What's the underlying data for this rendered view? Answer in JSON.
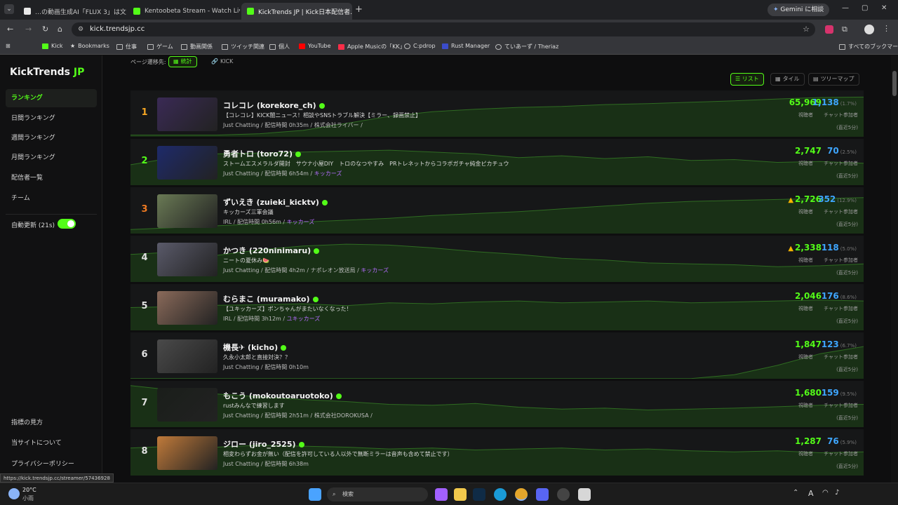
{
  "browser": {
    "tabs": [
      {
        "label": "…の動画生成AI「FLUX 3」は文…",
        "color": "#e8e8e8"
      },
      {
        "label": "Kentoobeta Stream - Watch Liv…",
        "color": "#53fc18"
      },
      {
        "label": "KickTrends JP | Kick日本配信者…",
        "color": "#53fc18"
      }
    ],
    "gemini_button": "Gemini に相談",
    "url": "kick.trendsjp.cc",
    "bookmarks": [
      {
        "label": "Kick"
      },
      {
        "label": "Bookmarks"
      },
      {
        "label": "仕事"
      },
      {
        "label": "ゲーム"
      },
      {
        "label": "動画関係"
      },
      {
        "label": "ツイッチ関連"
      },
      {
        "label": "個人"
      },
      {
        "label": "YouTube"
      },
      {
        "label": "Apple Musicの「KK」"
      },
      {
        "label": "C:pdrop"
      },
      {
        "label": "Rust Manager"
      },
      {
        "label": "ていあーず / Theriaz"
      }
    ],
    "all_bookmarks": "すべてのブックマーク"
  },
  "sidebar": {
    "brand_main": "KickTrends",
    "brand_accent": " JP",
    "items": [
      {
        "label": "ランキング"
      },
      {
        "label": "日間ランキング"
      },
      {
        "label": "週間ランキング"
      },
      {
        "label": "月間ランキング"
      },
      {
        "label": "配信者一覧"
      },
      {
        "label": "チーム"
      }
    ],
    "auto_refresh": "自動更新 (21s)",
    "footer": [
      {
        "label": "指標の見方"
      },
      {
        "label": "当サイトについて"
      },
      {
        "label": "プライバシーポリシー"
      }
    ]
  },
  "page": {
    "nav_label": "ページ遷移先:",
    "nav_stats": "統計",
    "nav_kick": "KICK",
    "view_list": "☰ リスト",
    "view_tile": "タイル",
    "view_treemap": "ツリーマップ",
    "viewer_label": "視聴者",
    "chatter_label": "チャット参加者",
    "recent_label": "(直近5分)"
  },
  "streamers": [
    {
      "rank": "1",
      "rank_color": "#f5a623",
      "name": "コレコレ (korekore_ch)",
      "title": "【コレコレ】KICK闇ニュース！相談やSNSトラブル解決【ミラー、録画禁止】",
      "meta": "Just Chatting / 配信時間 0h35m / 株式会社ライバー /",
      "team": "",
      "viewers": "65,969",
      "warn": false,
      "chatters": "1,138",
      "pct": "(1.7%)"
    },
    {
      "rank": "2",
      "rank_color": "#53fc18",
      "name": "勇者トロ (toro72)",
      "title": "ストームエスメラルダ開封　サウナ小屋DIY　トロのなつやすみ　PRトレネットからコラボガチャ純金ピカチュウ",
      "meta": "Just Chatting / 配信時間 6h54m / ",
      "team": "キッカーズ",
      "viewers": "2,747",
      "warn": false,
      "chatters": "70",
      "pct": "(2.5%)"
    },
    {
      "rank": "3",
      "rank_color": "#f07b22",
      "name": "ずいえき (zuieki_kicktv)",
      "title": "キッカーズ三軍会議",
      "meta": "IRL / 配信時間 0h56m / ",
      "team": "キッカーズ",
      "viewers": "2,726",
      "warn": true,
      "chatters": "352",
      "pct": "(12.9%)"
    },
    {
      "rank": "4",
      "rank_color": "#e0e0e0",
      "name": "かつき (220ninimaru)",
      "title": "ニートの夏休み🍉",
      "meta": "Just Chatting / 配信時間 4h2m / ナポレオン放送局 / ",
      "team": "キッカーズ",
      "viewers": "2,338",
      "warn": true,
      "chatters": "118",
      "pct": "(5.0%)"
    },
    {
      "rank": "5",
      "rank_color": "#e0e0e0",
      "name": "むらまこ (muramako)",
      "title": "【ユキッカーズ】ポンちゃんがまたいなくなった！",
      "meta": "IRL / 配信時間 3h12m / ",
      "team": "ユキッカーズ",
      "viewers": "2,046",
      "warn": false,
      "chatters": "176",
      "pct": "(8.6%)"
    },
    {
      "rank": "6",
      "rank_color": "#e0e0e0",
      "name": "機長✈ (kicho)",
      "title": "久永小太郎と直接対決？？",
      "meta": "Just Chatting / 配信時間 0h10m",
      "team": "",
      "viewers": "1,847",
      "warn": false,
      "chatters": "123",
      "pct": "(6.7%)"
    },
    {
      "rank": "7",
      "rank_color": "#e0e0e0",
      "name": "もこう (mokoutoaruotoko)",
      "title": "rustみんなで練習します",
      "meta": "Just Chatting / 配信時間 2h51m / 株式会社DOROKUSA /",
      "team": "",
      "viewers": "1,680",
      "warn": false,
      "chatters": "159",
      "pct": "(9.5%)"
    },
    {
      "rank": "8",
      "rank_color": "#e0e0e0",
      "name": "ジロー (jiro_2525)",
      "title": "相変わらずお金が無い（配信を許可している人以外で無断ミラーは音声も含めて禁止です）",
      "meta": "Just Chatting / 配信時間 6h38m",
      "team": "",
      "viewers": "1,287",
      "warn": false,
      "chatters": "76",
      "pct": "(5.9%)"
    }
  ],
  "status_url": "https://kick.trendsjp.cc/streamer/57436928",
  "taskbar": {
    "weather_temp": "20°C",
    "weather_desc": "小雨",
    "search": "検索",
    "ime": "A"
  },
  "colors": {
    "accent": "#53fc18",
    "chat": "#3ea6ff",
    "team": "#b46cff",
    "warn": "#f5b400"
  }
}
